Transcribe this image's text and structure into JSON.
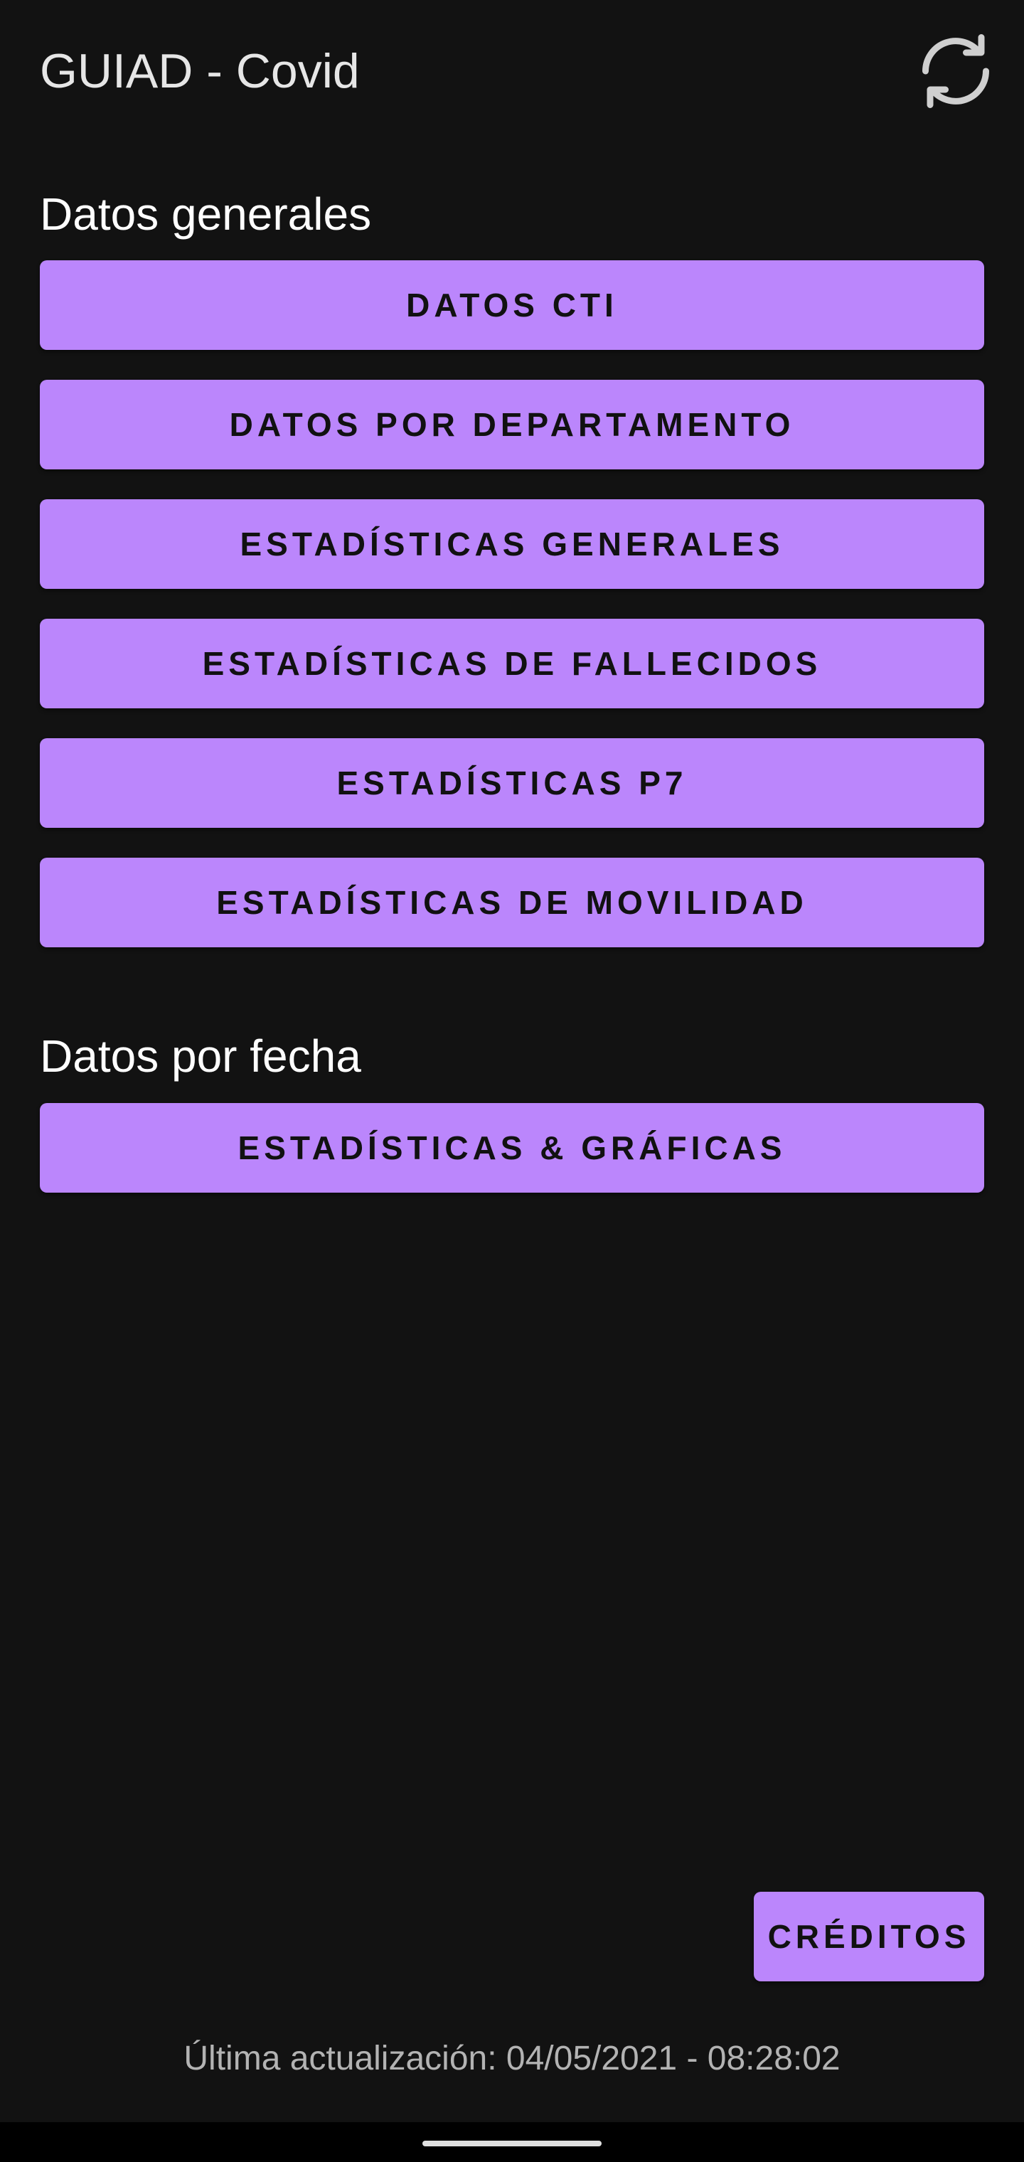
{
  "header": {
    "title": "GUIAD - Covid",
    "refresh_icon": "refresh-icon"
  },
  "sections": {
    "general": {
      "heading": "Datos generales",
      "buttons": [
        "DATOS CTI",
        "DATOS POR DEPARTAMENTO",
        "ESTADÍSTICAS GENERALES",
        "ESTADÍSTICAS DE FALLECIDOS",
        "ESTADÍSTICAS P7",
        "ESTADÍSTICAS DE MOVILIDAD"
      ]
    },
    "by_date": {
      "heading": "Datos por fecha",
      "buttons": [
        "ESTADÍSTICAS & GRÁFICAS"
      ]
    }
  },
  "credits_label": "CRÉDITOS",
  "footer": {
    "last_update": "Última actualización: 04/05/2021 - 08:28:02"
  },
  "colors": {
    "background": "#121212",
    "accent": "#bb86fc",
    "button_text": "#111111",
    "title_text": "#e6e6e6",
    "footer_text": "#b3b3b3"
  }
}
